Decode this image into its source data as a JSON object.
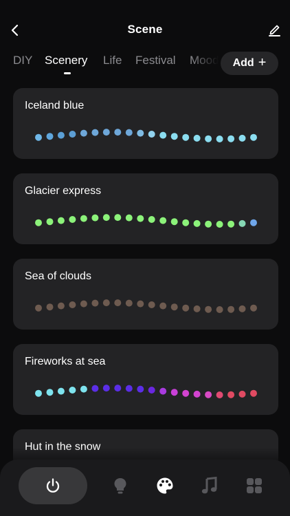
{
  "header": {
    "title": "Scene",
    "back_icon": "chevron-left-icon",
    "edit_icon": "pencil-icon"
  },
  "tabs": [
    {
      "label": "DIY",
      "active": false
    },
    {
      "label": "Scenery",
      "active": true
    },
    {
      "label": "Life",
      "active": false
    },
    {
      "label": "Festival",
      "active": false
    },
    {
      "label": "Mood",
      "active": false
    }
  ],
  "add_button": {
    "label": "Add",
    "icon": "plus-icon"
  },
  "scenes": [
    {
      "name": "Iceland blue",
      "colors": [
        "#6fb7e8",
        "#5fa6dc",
        "#5b9fd6",
        "#5c9ed4",
        "#6ea7d9",
        "#6ea7d9",
        "#6ea7d9",
        "#6ea7d9",
        "#6ea7d9",
        "#7fbbe3",
        "#92d3ef",
        "#8bddf0",
        "#8bddf0",
        "#8bddf0",
        "#8bddf0",
        "#8bddf0",
        "#8bddf0",
        "#8bddf0",
        "#8bddf0",
        "#8bddf0"
      ]
    },
    {
      "name": "Glacier express",
      "colors": [
        "#8cf27a",
        "#8cf27a",
        "#8cf27a",
        "#8cf27a",
        "#8cf27a",
        "#8cf27a",
        "#8cf27a",
        "#8cf27a",
        "#8cf27a",
        "#8cf27a",
        "#8cf27a",
        "#8cf27a",
        "#8cf27a",
        "#8cf27a",
        "#8cf27a",
        "#8cf27a",
        "#8cf27a",
        "#8cf27a",
        "#86d7b4",
        "#6fa6ea"
      ]
    },
    {
      "name": "Sea of clouds",
      "colors": [
        "#6e5b50",
        "#6e5b50",
        "#6e5b50",
        "#6e5b50",
        "#6e5b50",
        "#6e5b50",
        "#6e5b50",
        "#6e5b50",
        "#6e5b50",
        "#6e5b50",
        "#6e5b50",
        "#6e5b50",
        "#6e5b50",
        "#6e5b50",
        "#6e5b50",
        "#6e5b50",
        "#6e5b50",
        "#6e5b50",
        "#6e5b50",
        "#6e5b50"
      ]
    },
    {
      "name": "Fireworks at sea",
      "colors": [
        "#7ee3ee",
        "#7ee3ee",
        "#7ee3ee",
        "#7ee3ee",
        "#7ee3ee",
        "#5b2ee6",
        "#5b2ee6",
        "#5b2ee6",
        "#5b2ee6",
        "#5b2ee6",
        "#6a27e0",
        "#a93be0",
        "#c940d8",
        "#d243d0",
        "#d243d0",
        "#d84ac4",
        "#e04a72",
        "#e04a62",
        "#e04a62",
        "#e04a62"
      ]
    },
    {
      "name": "Hut in the snow",
      "colors": []
    }
  ],
  "bottom_nav": [
    {
      "name": "power-icon",
      "active": true
    },
    {
      "name": "bulb-icon",
      "active": false
    },
    {
      "name": "palette-icon",
      "active": true
    },
    {
      "name": "music-note-icon",
      "active": false
    },
    {
      "name": "grid-icon",
      "active": false
    }
  ],
  "accent": "#ffffff"
}
